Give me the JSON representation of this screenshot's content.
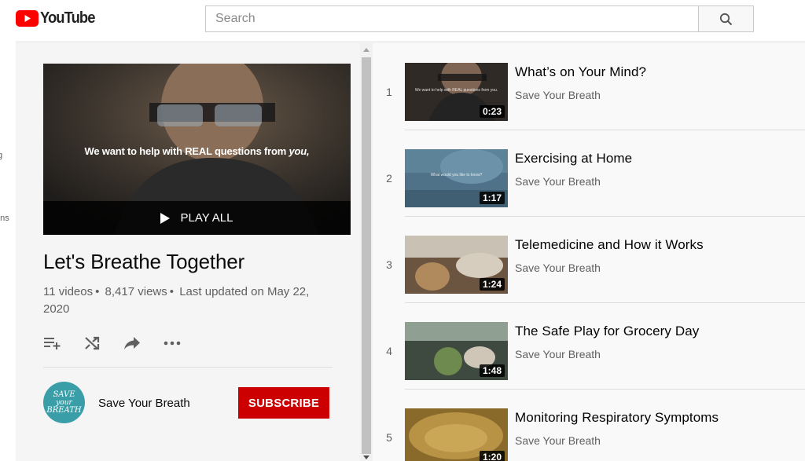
{
  "header": {
    "logo_text": "YouTube",
    "search_placeholder": "Search",
    "search_icon": "search-icon"
  },
  "sidebar": {
    "fragments": [
      "g",
      "ons"
    ]
  },
  "playlist": {
    "hero_caption_prefix": "We want to help with REAL questions from",
    "hero_caption_emph": "you,",
    "play_all_label": "PLAY ALL",
    "title": "Let's Breathe Together",
    "video_count": "11 videos",
    "views": "8,417 views",
    "updated": "Last updated on May 22, 2020",
    "sep": "•",
    "actions": [
      "add-to-queue-icon",
      "shuffle-icon",
      "share-icon",
      "more-icon"
    ]
  },
  "channel": {
    "name": "Save Your Breath",
    "avatar_text": [
      "SAVE",
      "your",
      "BREATH"
    ],
    "subscribe_label": "SUBSCRIBE"
  },
  "videos": [
    {
      "index": "1",
      "title": "What’s on Your Mind?",
      "channel": "Save Your Breath",
      "duration": "0:23",
      "thumb_text": "We want to help with REAL questions from you."
    },
    {
      "index": "2",
      "title": "Exercising at Home",
      "channel": "Save Your Breath",
      "duration": "1:17",
      "thumb_text": "What would you like to know?"
    },
    {
      "index": "3",
      "title": "Telemedicine and How it Works",
      "channel": "Save Your Breath",
      "duration": "1:24",
      "thumb_text": ""
    },
    {
      "index": "4",
      "title": "The Safe Play for Grocery Day",
      "channel": "Save Your Breath",
      "duration": "1:48",
      "thumb_text": ""
    },
    {
      "index": "5",
      "title": "Monitoring Respiratory Symptoms",
      "channel": "Save Your Breath",
      "duration": "1:20",
      "thumb_text": ""
    }
  ],
  "colors": {
    "brand_red": "#ff0000",
    "subscribe_red": "#cc0000",
    "avatar_teal": "#3a9ea8"
  }
}
